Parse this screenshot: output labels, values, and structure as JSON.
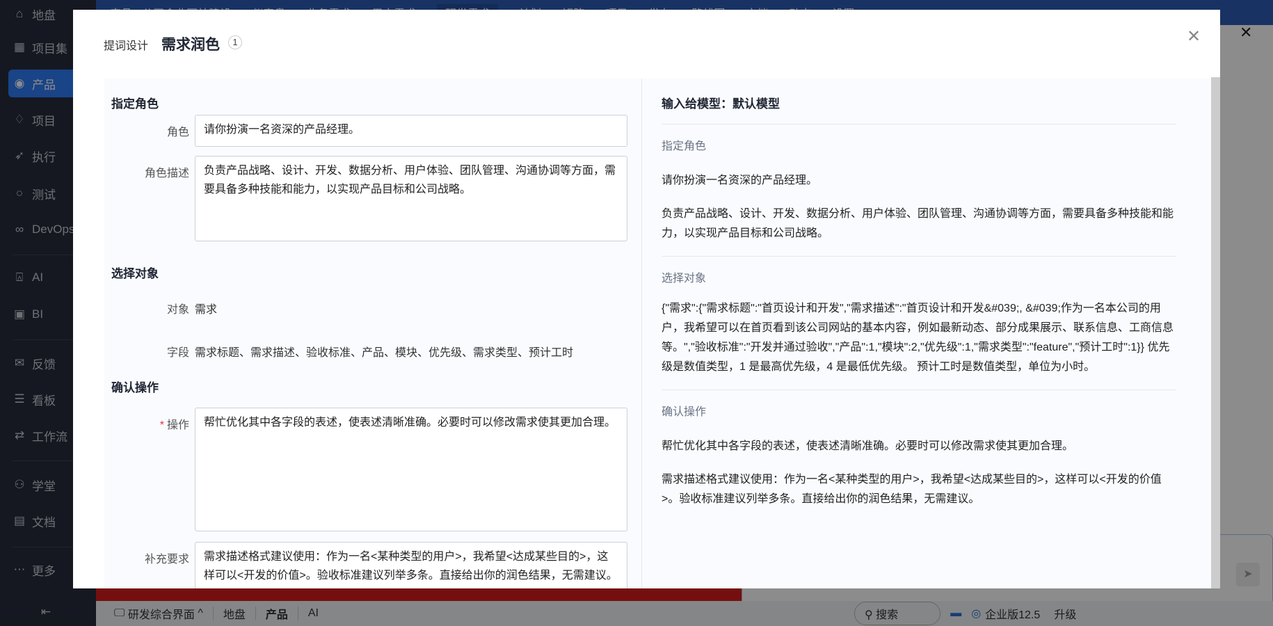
{
  "sidebar": {
    "items": [
      {
        "label": "地盘",
        "icon": "home-icon"
      },
      {
        "label": "项目集",
        "icon": "grid-icon"
      },
      {
        "label": "产品",
        "icon": "bulb-icon"
      },
      {
        "label": "项目",
        "icon": "rocket-icon"
      },
      {
        "label": "执行",
        "icon": "run-icon"
      },
      {
        "label": "测试",
        "icon": "search-icon"
      },
      {
        "label": "DevOps",
        "icon": "infinity-icon"
      },
      {
        "label": "AI",
        "icon": "robot-icon"
      },
      {
        "label": "BI",
        "icon": "chart-board-icon"
      },
      {
        "label": "反馈",
        "icon": "feedback-icon"
      },
      {
        "label": "看板",
        "icon": "kanban-icon"
      },
      {
        "label": "工作流",
        "icon": "workflow-icon"
      },
      {
        "label": "学堂",
        "icon": "school-icon"
      },
      {
        "label": "文档",
        "icon": "doc-icon"
      },
      {
        "label": "更多",
        "icon": "more-icon"
      }
    ]
  },
  "topbar": {
    "breadcrumb": "产品 › 公司企业网站建设",
    "items": [
      "仪表盘",
      "业务需求",
      "用户需求",
      "研发需求",
      "计划",
      "矩阵",
      "项目",
      "发布",
      "路线图",
      "文档",
      "动态",
      "设置"
    ],
    "active": "研发需求"
  },
  "bottombar": {
    "workspace": "研发综合界面",
    "tabs": [
      "地盘",
      "产品",
      "AI"
    ],
    "search": "搜索",
    "edition": "企业版12.5",
    "upgrade": "升级"
  },
  "modal": {
    "subtitle": "提词设计",
    "title": "需求润色",
    "badge": "1",
    "left": {
      "section_role": "指定角色",
      "role_label": "角色",
      "role_value": "请你扮演一名资深的产品经理。",
      "role_desc_label": "角色描述",
      "role_desc_value": "负责产品战略、设计、开发、数据分析、用户体验、团队管理、沟通协调等方面，需要具备多种技能和能力，以实现产品目标和公司战略。",
      "section_object": "选择对象",
      "object_label": "对象",
      "object_value": "需求",
      "fields_label": "字段",
      "fields_value": "需求标题、需求描述、验收标准、产品、模块、优先级、需求类型、预计工时",
      "section_action": "确认操作",
      "action_label": "操作",
      "action_value": "帮忙优化其中各字段的表述，使表述清晰准确。必要时可以修改需求使其更加合理。",
      "extra_label": "补充要求",
      "extra_value": "需求描述格式建议使用：作为一名<某种类型的用户>，我希望<达成某些目的>，这样可以<开发的价值>。验收标准建议列举多条。直接给出你的润色结果，无需建议。"
    },
    "right": {
      "heading": "输入给模型：默认模型",
      "s1": "指定角色",
      "s1_p1": "请你扮演一名资深的产品经理。",
      "s1_p2": "负责产品战略、设计、开发、数据分析、用户体验、团队管理、沟通协调等方面，需要具备多种技能和能力，以实现产品目标和公司战略。",
      "s2": "选择对象",
      "s2_p1": "{\"需求\":{\"需求标题\":\"首页设计和开发\",\"需求描述\":\"首页设计和开发&#039;, &#039;作为一名本公司的用户，我希望可以在首页看到该公司网站的基本内容，例如最新动态、部分成果展示、联系信息、工商信息等。\",\"验收标准\":\"开发并通过验收\",\"产品\":1,\"模块\":2,\"优先级\":1,\"需求类型\":\"feature\",\"预计工时\":1}} 优先级是数值类型，1 是最高优先级，4 是最低优先级。 预计工时是数值类型，单位为小时。",
      "s3": "确认操作",
      "s3_p1": "帮忙优化其中各字段的表述，使表述清晰准确。必要时可以修改需求使其更加合理。",
      "s3_p2": "需求描述格式建议使用：作为一名<某种类型的用户>，我希望<达成某些目的>，这样可以<开发的价值>。验收标准建议列举多条。直接给出你的润色结果，无需建议。"
    }
  }
}
